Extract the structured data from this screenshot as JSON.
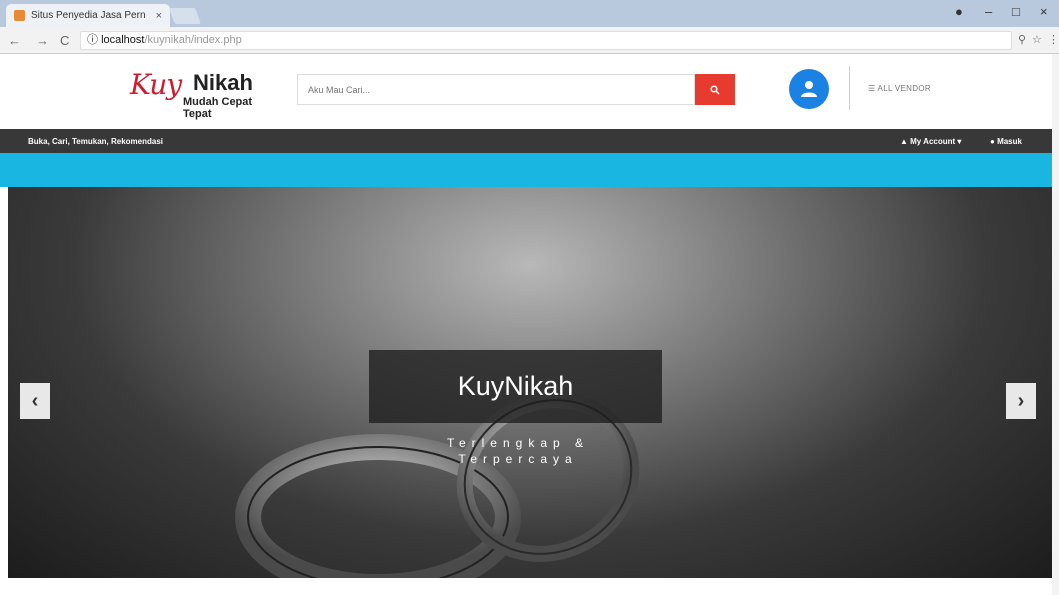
{
  "browser": {
    "tab_title": "Situs Penyedia Jasa Pern",
    "tab_close": "×",
    "url_host": "localhost",
    "url_path": "/kuynikah/index.php",
    "back": "←",
    "forward": "→",
    "reload": "C",
    "info": "ⓘ",
    "minimize": "–",
    "maximize": "□",
    "close": "×"
  },
  "header": {
    "logo_script": "Kuy",
    "logo_big": "Nikah",
    "logo_small": "Mudah Cepat Tepat",
    "search_placeholder": "Aku Mau Cari...",
    "vendor_link": "☰ ALL VENDOR"
  },
  "nav": {
    "tagline": "Buka, Cari, Temukan, Rekomendasi",
    "account": "My Account ▾",
    "masuk": "Masuk"
  },
  "carousel": {
    "title": "KuyNikah",
    "subtitle": "Terlengkap & Terpercaya",
    "prev": "‹",
    "next": "›"
  },
  "colors": {
    "search_button": "#e63b2e",
    "user_circle": "#1a82e2",
    "cyan_bar": "#18b6e0",
    "dark_nav": "#383838"
  }
}
